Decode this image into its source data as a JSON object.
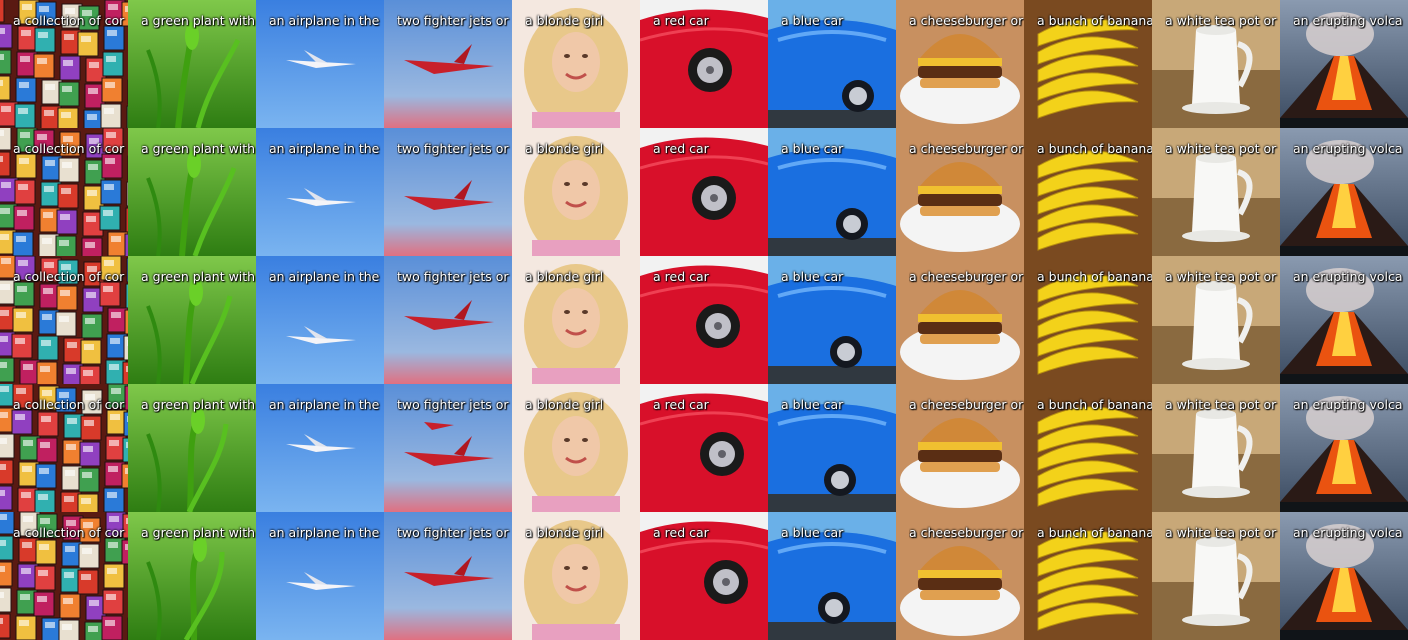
{
  "grid": {
    "rows": 5,
    "columns": 11,
    "captions": [
      "a collection of comic books",
      "a green plant with a bud",
      "an airplane in the sky",
      "two fighter jets on",
      "a blonde girl",
      "a red car",
      "a blue car",
      "a cheeseburger on a plate",
      "a bunch of bananas",
      "a white tea pot on",
      "an erupting volcano"
    ],
    "captions_shown": [
      "a collection of cor",
      "a green plant with",
      "an airplane in the",
      "two fighter jets or",
      "a blonde girl",
      "a red car",
      "a blue car",
      "a cheeseburger or",
      "a bunch of banana",
      "a white tea pot or",
      "an erupting volca"
    ],
    "subjects": [
      "comics",
      "plant",
      "airplane",
      "jets",
      "girl",
      "redcar",
      "bluecar",
      "burger",
      "bananas",
      "teapot",
      "volcano"
    ],
    "row_captions": [
      [
        "a collection of cor",
        "a green plant with",
        "an airplane in the",
        "two fighter jets or",
        "a blonde girl",
        "a red car",
        "a blue car",
        "a cheeseburger or",
        "a bunch of banana",
        "a white tea pot or",
        "an erupting volca"
      ],
      [
        "a collection of cor",
        "a green plant with",
        "an airplane in the",
        "two fighter jets or",
        "a blonde girl",
        "a red car",
        "a blue car",
        "a cheeseburger or",
        "a bunch of banana",
        "a white tea pot or",
        "an erupting volca"
      ],
      [
        "a collection of cor",
        "a green plant with",
        "an airplane in the",
        "two fighter jets or",
        "a blonde girl",
        "a red car",
        "a blue car",
        "a cheeseburger or",
        "a bunch of banana",
        "a white tea pot or",
        "an erupting volca"
      ],
      [
        "a collection of cor",
        "a green plant with",
        "an airplane in the",
        "two fighter jets or",
        "a blonde girl",
        "a red car",
        "a blue car",
        "a cheeseburger or",
        "a bunch of banana",
        "a white tea pot or",
        "an erupting volca"
      ],
      [
        "a collection of cor",
        "a green plant with",
        "an airplane in the",
        "two fighter jets or",
        "a blonde girl",
        "a red car",
        "a blue car",
        "a cheeseburger or",
        "a bunch of banana",
        "a white tea pot or",
        "an erupting volca"
      ]
    ]
  },
  "colors": {
    "sky": "#4a8de0",
    "grass": "#4caf1e",
    "red_car": "#d8102a",
    "blue_car": "#1a6fe0",
    "banana": "#f3d21a",
    "lava": "#ff5a10",
    "caption": "#ffffff"
  }
}
